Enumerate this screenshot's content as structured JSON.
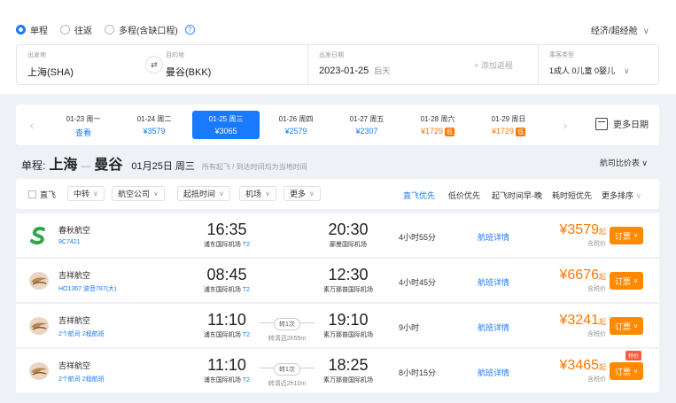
{
  "trip_types": [
    {
      "label": "单程",
      "selected": true
    },
    {
      "label": "往返",
      "selected": false
    },
    {
      "label": "多程(含缺口程)",
      "selected": false
    }
  ],
  "help_glyph": "?",
  "cabin_class": "经济/超经舱",
  "search": {
    "from_label": "出发地",
    "from_value": "上海(SHA)",
    "to_label": "目的地",
    "to_value": "曼谷(BKK)",
    "date_label": "出发日期",
    "date_value": "2023-01-25",
    "date_weekday": "后天",
    "return_placeholder": "+ 添加返程",
    "pax_label": "乘客类型",
    "pax_value": "1成人  0儿童  0婴儿"
  },
  "dates": [
    {
      "date": "01-23 周一",
      "price": "查看"
    },
    {
      "date": "01-24 周二",
      "price": "¥3579"
    },
    {
      "date": "01-25 周三",
      "price": "¥3065",
      "selected": true
    },
    {
      "date": "01-26 周四",
      "price": "¥2579"
    },
    {
      "date": "01-27 周五",
      "price": "¥2307"
    },
    {
      "date": "01-28 周六",
      "price": "¥1729",
      "tag": "低",
      "low": true
    },
    {
      "date": "01-29 周日",
      "price": "¥1729",
      "tag": "低",
      "low": true
    }
  ],
  "more_dates": "更多日期",
  "route": {
    "kind": "单程:",
    "from": "上海",
    "to": "曼谷",
    "date": "01月25日 周三",
    "note": "所有起飞 / 到达时间均为当地时间",
    "compare": "航司比价表"
  },
  "filters": {
    "direct": "直飞",
    "dropdowns": [
      "中转",
      "航空公司",
      "起抵时间",
      "机场",
      "更多"
    ],
    "sorts": [
      "直飞优先",
      "低价优先",
      "起飞时间早-晚",
      "耗时短优先",
      "更多排序"
    ]
  },
  "flights": [
    {
      "airline": "春秋航空",
      "sub": "9C7421",
      "dep": "16:35",
      "dep_ap": "浦东国际机场",
      "dep_term": "T2",
      "arr": "20:30",
      "arr_ap": "廊曼国际机场",
      "stop": "",
      "via": "",
      "duration": "4小时55分",
      "detail": "航班详情",
      "price": "¥3579",
      "qi": "起",
      "tax": "含税价",
      "book": "订票",
      "badge": "",
      "logo": "spring"
    },
    {
      "airline": "吉祥航空",
      "sub": "HO1367 波音787(大)",
      "dep": "08:45",
      "dep_ap": "浦东国际机场",
      "dep_term": "T2",
      "arr": "12:30",
      "arr_ap": "素万那普国际机场",
      "stop": "",
      "via": "",
      "duration": "4小时45分",
      "detail": "航班详情",
      "price": "¥6676",
      "qi": "起",
      "tax": "含税价",
      "book": "订票",
      "badge": "",
      "logo": "juneyao"
    },
    {
      "airline": "吉祥航空",
      "sub": "2个航司  2程航班",
      "dep": "11:10",
      "dep_ap": "浦东国际机场",
      "dep_term": "T2",
      "arr": "19:10",
      "arr_ap": "素万那普国际机场",
      "stop": "转1次",
      "via": "转清迈2h55m",
      "duration": "9小时",
      "detail": "航班详情",
      "price": "¥3241",
      "qi": "起",
      "tax": "含税价",
      "book": "订票",
      "badge": "",
      "logo": "juneyao"
    },
    {
      "airline": "吉祥航空",
      "sub": "2个航司  2程航班",
      "dep": "11:10",
      "dep_ap": "浦东国际机场",
      "dep_term": "T2",
      "arr": "18:25",
      "arr_ap": "素万那普国际机场",
      "stop": "转1次",
      "via": "转清迈2h10m",
      "duration": "8小时15分",
      "detail": "航班详情",
      "price": "¥3465",
      "qi": "起",
      "tax": "含税价",
      "book": "订票",
      "badge": "特价",
      "logo": "juneyao"
    }
  ]
}
